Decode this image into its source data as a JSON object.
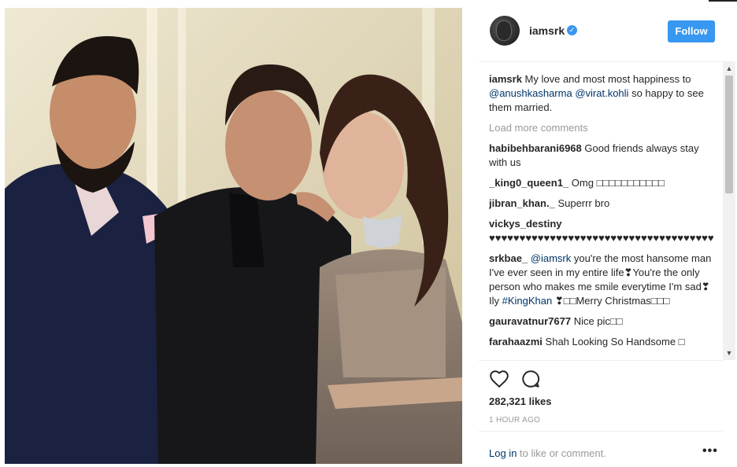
{
  "post": {
    "username": "iamsrk",
    "follow_label": "Follow",
    "likes": "282,321 likes",
    "timestamp": "1 HOUR AGO",
    "login_link": "Log in",
    "login_suffix": "to like or comment.",
    "more": "•••"
  },
  "caption": {
    "user": "iamsrk",
    "text_1": "My love and most most happiness to",
    "mention_1": "@anushkasharma",
    "mention_2": "@virat.kohli",
    "text_2": "so happy to see them married."
  },
  "load_more": "Load more comments",
  "comments": [
    {
      "user": "habibehbarani6968",
      "text": "Good friends always stay with us"
    },
    {
      "user": "_king0_queen1_",
      "text": "Omg □□□□□□□□□□□"
    },
    {
      "user": "jibran_khan._",
      "text": "Superrr bro"
    },
    {
      "user": "vickys_destiny",
      "text": "♥♥♥♥♥♥♥♥♥♥♥♥♥♥♥♥♥♥♥♥♥♥♥♥♥♥♥♥♥♥♥♥♥♥♥♥♥♥♥♥♥"
    },
    {
      "user": "srkbae_",
      "mention": "@iamsrk",
      "text": "you're the most hansome man I've ever seen in my entire life❣You're the only person who makes me smile everytime I'm sad❣Ily",
      "hashtag": "#KingKhan",
      "text_after": "❣□□Merry Christmas□□□"
    },
    {
      "user": "gauravatnur7677",
      "text": "Nice pic□□"
    },
    {
      "user": "farahaazmi",
      "text": "Shah Looking So Handsome □"
    }
  ],
  "icons": {
    "heart": "heart-icon",
    "comment": "comment-icon",
    "verified": "verified-badge-icon"
  },
  "colors": {
    "accent": "#3897f0",
    "link": "#003569",
    "muted": "#999999"
  }
}
